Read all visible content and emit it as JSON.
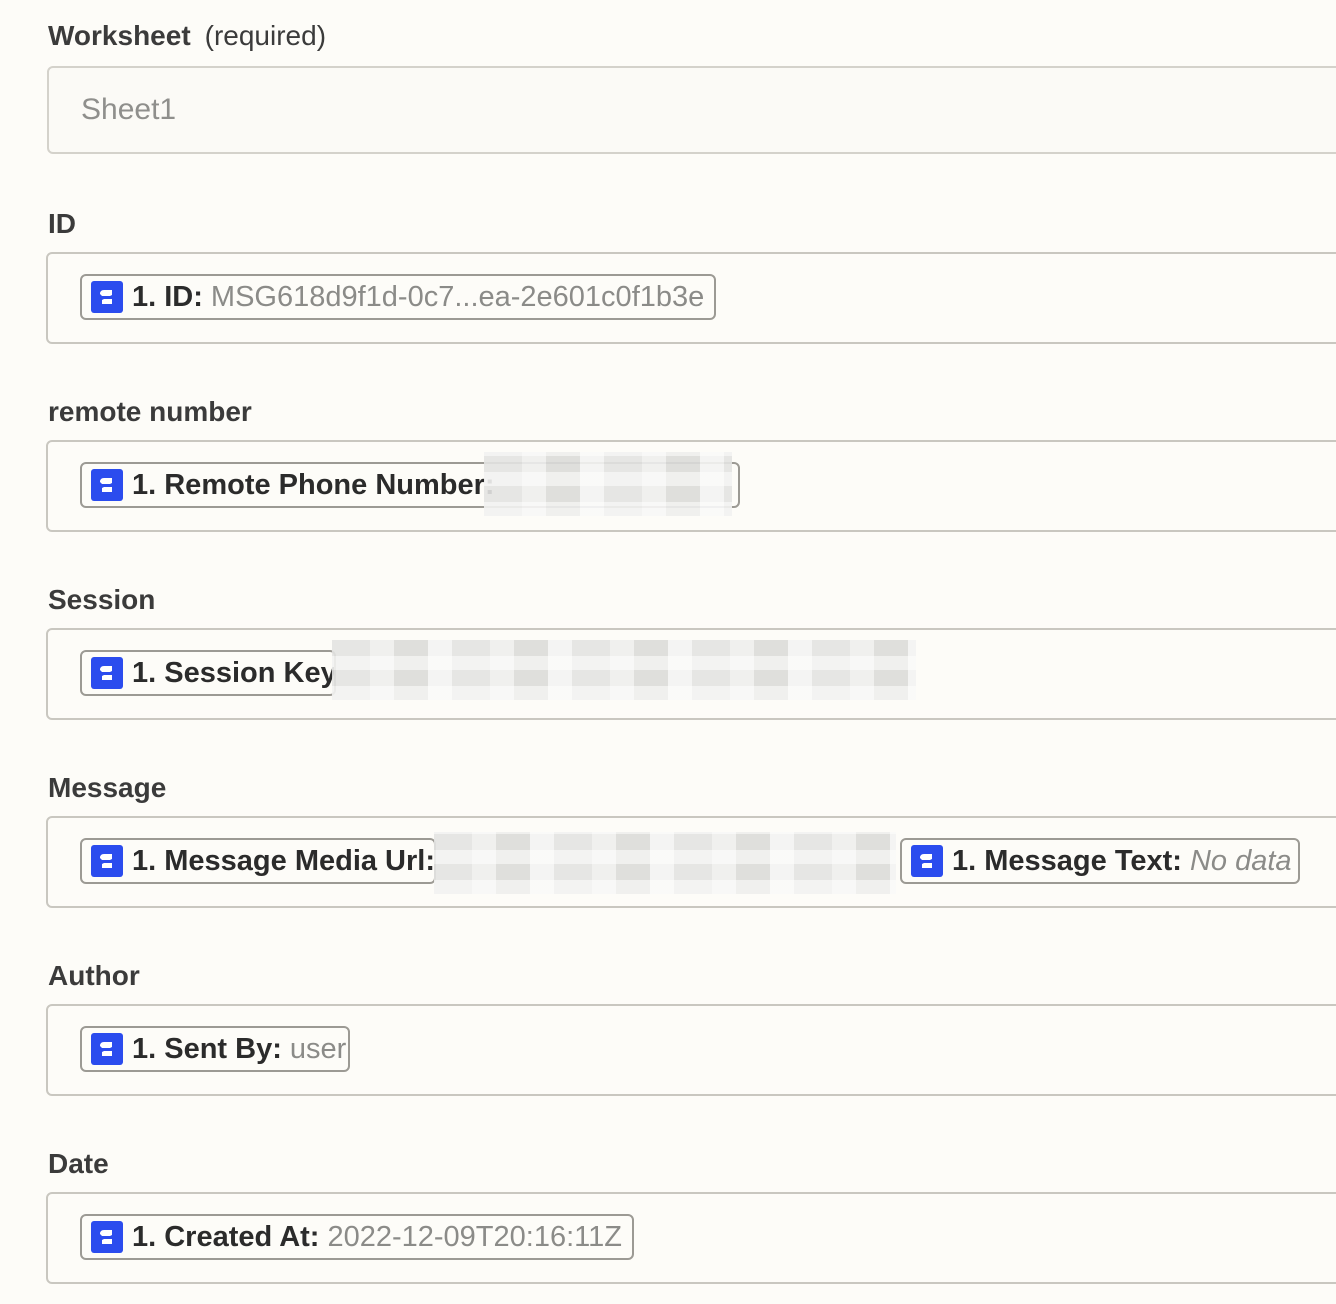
{
  "fields": {
    "worksheet": {
      "label": "Worksheet",
      "required": "(required)",
      "placeholder": "Sheet1"
    },
    "id": {
      "label": "ID",
      "pill_label": "1. ID:",
      "pill_value": "MSG618d9f1d-0c7...ea-2e601c0f1b3e"
    },
    "remote_number": {
      "label": "remote number",
      "pill_label": "1. Remote Phone Number:"
    },
    "session": {
      "label": "Session",
      "pill_label": "1. Session Key:"
    },
    "message": {
      "label": "Message",
      "pill1_label": "1. Message Media Url:",
      "pill2_label": "1. Message Text:",
      "pill2_value": "No data"
    },
    "author": {
      "label": "Author",
      "pill_label": "1. Sent By:",
      "pill_value": "user"
    },
    "date": {
      "label": "Date",
      "pill_label": "1. Created At:",
      "pill_value": "2022-12-09T20:16:11Z"
    }
  },
  "colors": {
    "app_icon": "#2b4cee",
    "background": "#fdfcf8"
  },
  "icons": {
    "app": "app-connector-icon"
  }
}
